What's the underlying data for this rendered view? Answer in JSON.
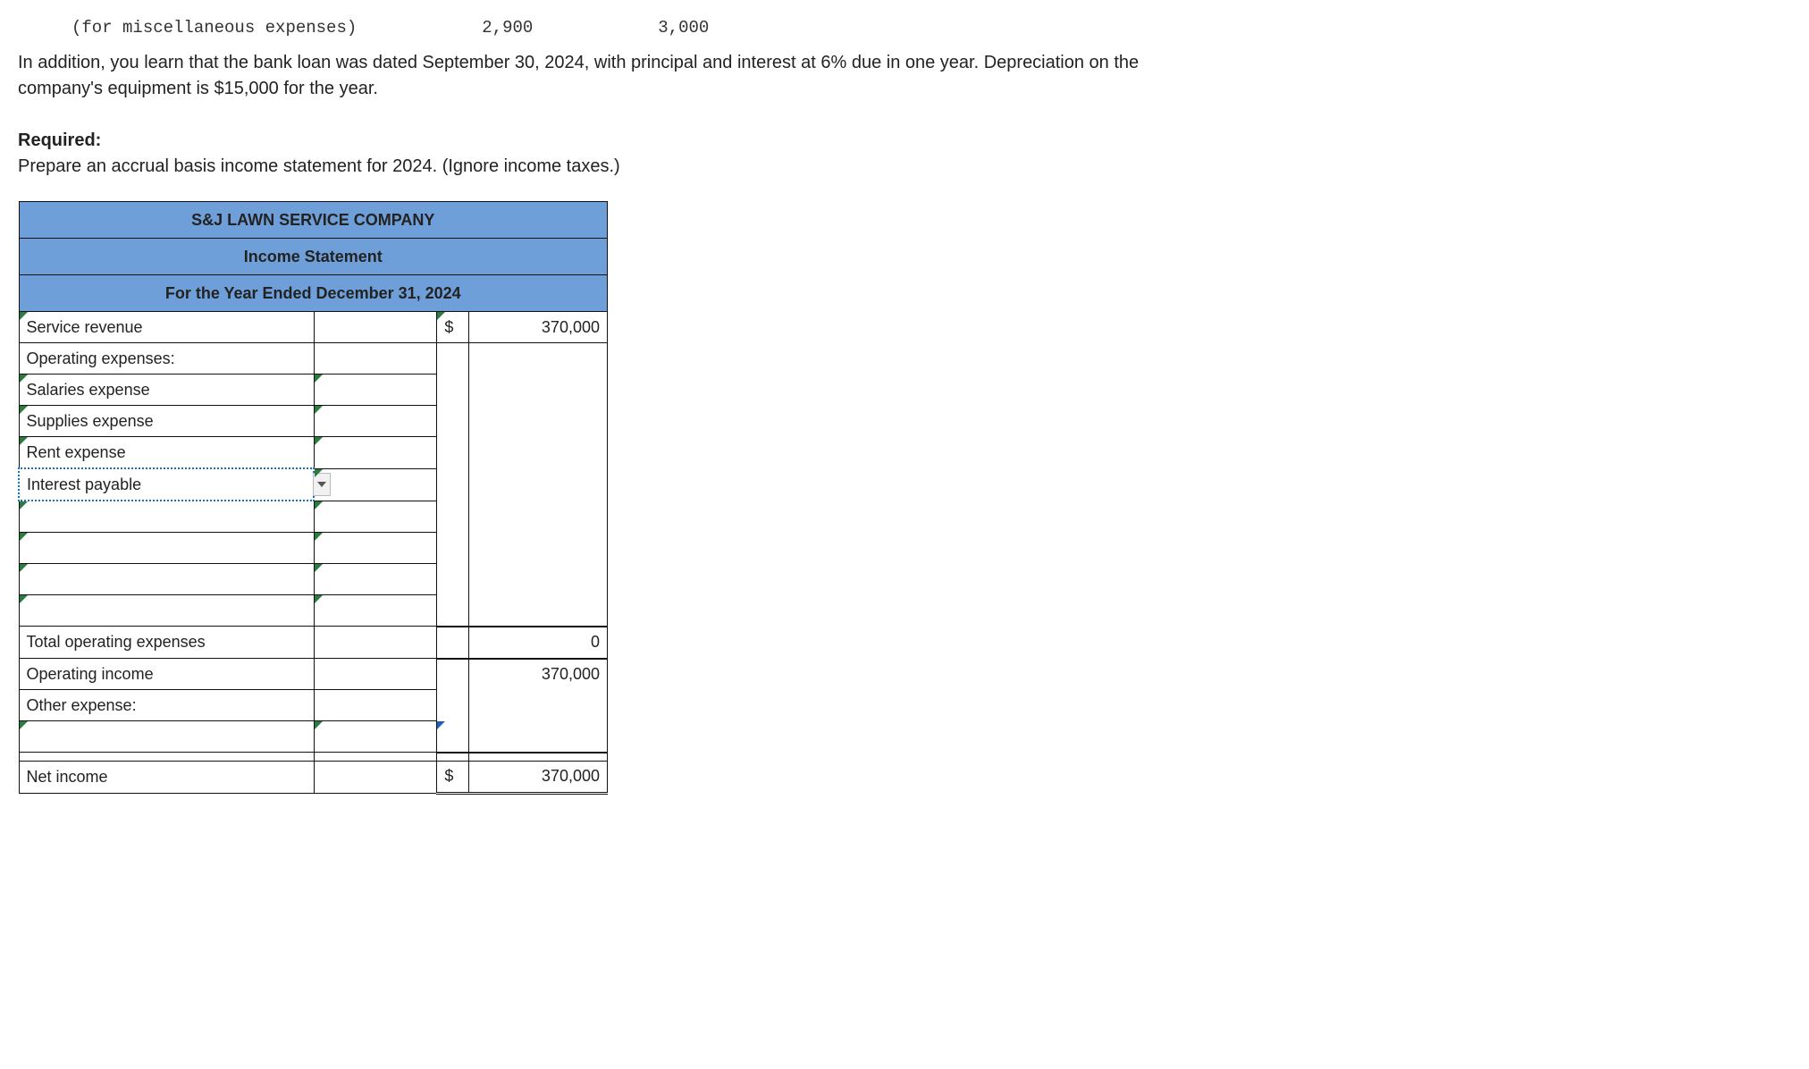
{
  "cutoff": {
    "text": "(for miscellaneous expenses)",
    "num1": "2,900",
    "num2": "3,000"
  },
  "prose": {
    "line1": "In addition, you learn that the bank loan was dated September 30, 2024, with principal and interest at 6% due in one year. Depreciation on the company's equipment is $15,000 for the year.",
    "req_label": "Required:",
    "req_text": "Prepare an accrual basis income statement for 2024. (Ignore income taxes.)"
  },
  "sheet": {
    "title1": "S&J LAWN SERVICE COMPANY",
    "title2": "Income Statement",
    "title3": "For the Year Ended December 31, 2024",
    "rows": {
      "service_rev": "Service revenue",
      "op_exp_hdr": "Operating expenses:",
      "salaries": "Salaries expense",
      "supplies": "Supplies expense",
      "rent": "Rent expense",
      "interest_payable": "Interest payable",
      "total_op": "Total operating expenses",
      "op_income": "Operating income",
      "other_exp": "Other expense:",
      "net_income": "Net income"
    },
    "vals": {
      "service_rev": "370,000",
      "total_op": "0",
      "op_income": "370,000",
      "net_income": "370,000"
    },
    "currency": "$"
  }
}
